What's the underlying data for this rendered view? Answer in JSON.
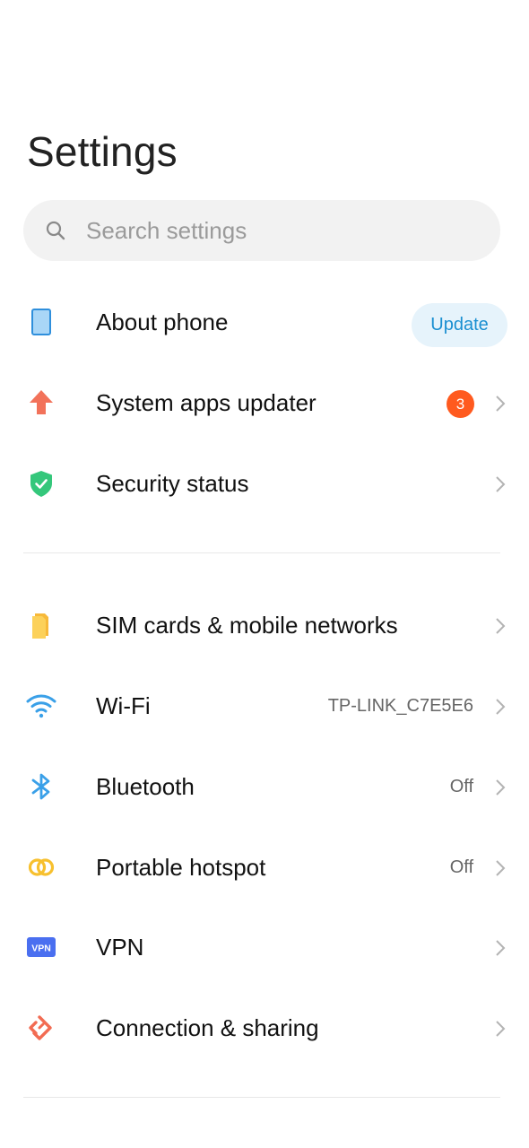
{
  "header": {
    "title": "Settings"
  },
  "search": {
    "placeholder": "Search settings"
  },
  "sections": [
    {
      "items": [
        {
          "label": "About phone",
          "action_label": "Update",
          "icon": "phone-icon"
        },
        {
          "label": "System apps updater",
          "badge": "3",
          "icon": "arrow-up-icon"
        },
        {
          "label": "Security status",
          "icon": "shield-check-icon"
        }
      ]
    },
    {
      "items": [
        {
          "label": "SIM cards & mobile networks",
          "icon": "sim-card-icon"
        },
        {
          "label": "Wi-Fi",
          "value": "TP-LINK_C7E5E6",
          "icon": "wifi-icon"
        },
        {
          "label": "Bluetooth",
          "value": "Off",
          "icon": "bluetooth-icon"
        },
        {
          "label": "Portable hotspot",
          "value": "Off",
          "icon": "hotspot-icon"
        },
        {
          "label": "VPN",
          "icon": "vpn-icon",
          "icon_text": "VPN"
        },
        {
          "label": "Connection & sharing",
          "icon": "connection-sharing-icon"
        }
      ]
    }
  ],
  "colors": {
    "accent_blue": "#1a8fd1",
    "badge_orange": "#ff5a1f",
    "update_pill_bg": "#e6f3fb"
  }
}
